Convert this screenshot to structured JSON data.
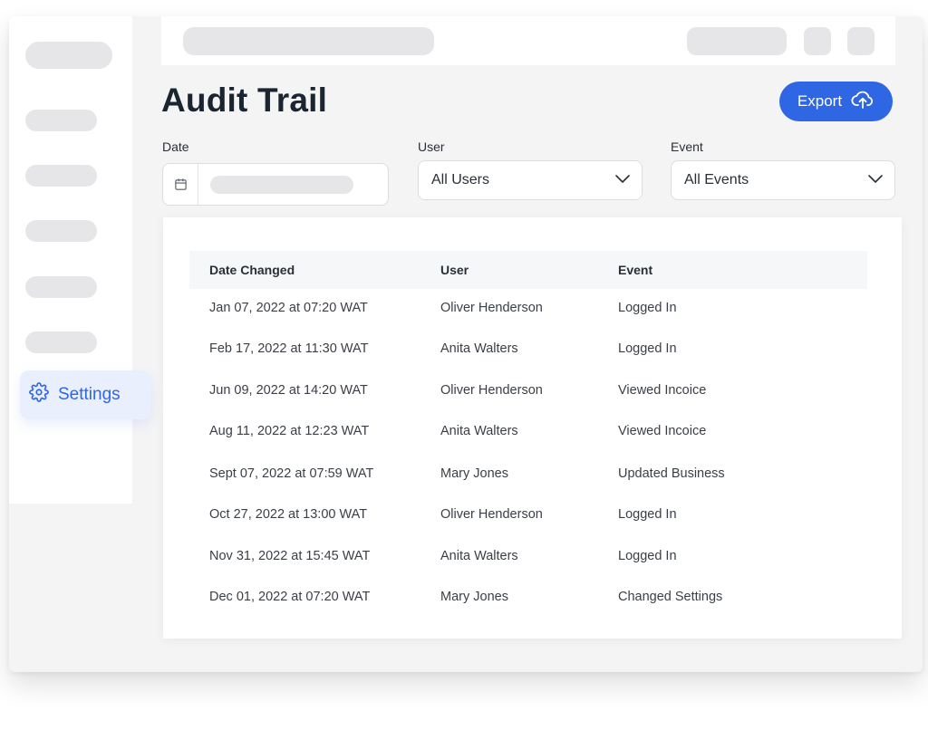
{
  "sidebar": {
    "settings_label": "Settings"
  },
  "page": {
    "title": "Audit Trail",
    "export_label": "Export"
  },
  "filters": {
    "date_label": "Date",
    "user_label": "User",
    "user_value": "All Users",
    "event_label": "Event",
    "event_value": "All Events"
  },
  "table": {
    "headers": [
      "Date Changed",
      "User",
      "Event"
    ],
    "rows": [
      [
        "Jan 07, 2022 at 07:20 WAT",
        "Oliver Henderson",
        "Logged In"
      ],
      [
        "Feb 17, 2022 at 11:30 WAT",
        "Anita Walters",
        "Logged In"
      ],
      [
        "Jun 09, 2022 at 14:20 WAT",
        "Oliver Henderson",
        "Viewed Incoice"
      ],
      [
        "Aug 11, 2022 at 12:23 WAT",
        "Anita Walters",
        "Viewed Incoice"
      ],
      [
        "Sept 07, 2022 at 07:59 WAT",
        "Mary Jones",
        "Updated Business"
      ],
      [
        "Oct 27, 2022 at 13:00 WAT",
        "Oliver Henderson",
        "Logged In"
      ],
      [
        "Nov 31, 2022 at 15:45 WAT",
        "Anita Walters",
        "Logged In"
      ],
      [
        "Dec 01, 2022 at 07:20 WAT",
        "Mary Jones",
        "Changed Settings"
      ]
    ]
  },
  "colors": {
    "accent": "#2f66e3",
    "title": "#1b2431",
    "skeleton": "#e6e6e8",
    "settings_bg": "#e9effc"
  },
  "icons": {
    "settings": "gear-icon",
    "export": "cloud-upload-icon",
    "date": "calendar-icon",
    "dropdown": "chevron-down-icon"
  }
}
